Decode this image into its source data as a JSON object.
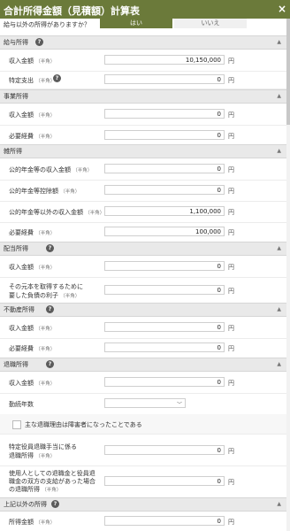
{
  "title": "合計所得金額（見積額）計算表",
  "question": "給与以外の所得がありますか？",
  "toggle": {
    "yes": "はい",
    "no": "いいえ"
  },
  "unit": "円",
  "note_half_width": "（半角）",
  "sections": {
    "salary": "給与所得",
    "business": "事業所得",
    "misc": "雑所得",
    "dividend": "配当所得",
    "realestate": "不動産所得",
    "retirement": "退職所得",
    "other": "上記以外の所得"
  },
  "fields": {
    "salary_income": {
      "label": "収入金額",
      "value": "10,150,000"
    },
    "salary_special": {
      "label": "特定支出",
      "value": "0"
    },
    "business_income": {
      "label": "収入金額",
      "value": "0"
    },
    "business_expense": {
      "label": "必要経費",
      "value": "0"
    },
    "pension_income": {
      "label": "公的年金等の収入金額",
      "value": "0"
    },
    "pension_deduction": {
      "label": "公的年金等控除額",
      "value": "0"
    },
    "misc_other_income": {
      "label": "公的年金等以外の収入金額",
      "value": "1,100,000"
    },
    "misc_expense": {
      "label": "必要経費",
      "value": "100,000"
    },
    "dividend_income": {
      "label": "収入金額",
      "value": "0"
    },
    "dividend_debt_interest": {
      "label1": "その元本を取得するために",
      "label2": "要した負債の利子",
      "value": "0"
    },
    "realestate_income": {
      "label": "収入金額",
      "value": "0"
    },
    "realestate_expense": {
      "label": "必要経費",
      "value": "0"
    },
    "retirement_income": {
      "label": "収入金額",
      "value": "0"
    },
    "service_years": {
      "label": "勤続年数",
      "value": ""
    },
    "disability_check": {
      "label": "主な退職理由は障害者になったことである"
    },
    "specified_officer": {
      "label1": "特定役員退職手当に係る",
      "label2": "退職所得",
      "value": "0"
    },
    "both_allowances": {
      "label1": "使用人としての退職金と役員退",
      "label2": "職金の双方の支給があった場合",
      "label3": "の退職所得",
      "value": "0"
    },
    "other_income": {
      "label": "所得金額",
      "value": "0"
    }
  },
  "icons": {
    "help": "?",
    "caret": "▲",
    "close": "×",
    "chevron": "﹀"
  }
}
